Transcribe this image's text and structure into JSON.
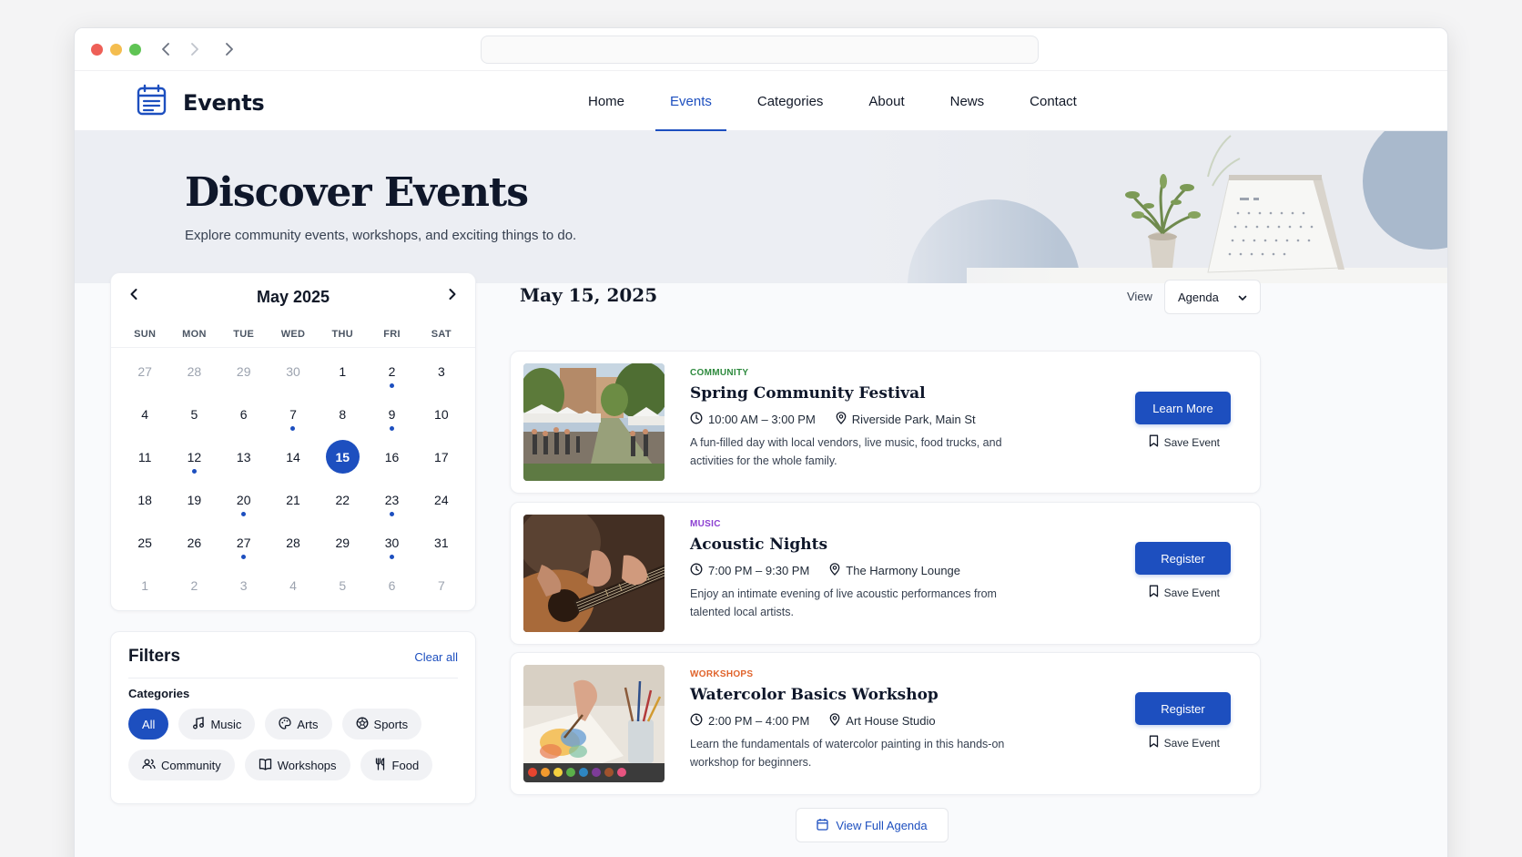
{
  "site": {
    "brand": "Events",
    "brand_icon": "calendar-icon"
  },
  "nav": {
    "items": [
      {
        "label": "Home",
        "active": false
      },
      {
        "label": "Events",
        "active": true
      },
      {
        "label": "Categories",
        "active": false
      },
      {
        "label": "About",
        "active": false
      },
      {
        "label": "News",
        "active": false
      },
      {
        "label": "Contact",
        "active": false
      }
    ]
  },
  "hero": {
    "title": "Discover Events",
    "subtitle": "Explore community events, workshops, and exciting things to do."
  },
  "calendar": {
    "month": "May 2025",
    "weekdays": [
      "SUN",
      "MON",
      "TUE",
      "WED",
      "THU",
      "FRI",
      "SAT"
    ],
    "selected": "15",
    "days": [
      {
        "d": "27",
        "m": true
      },
      {
        "d": "28",
        "m": true
      },
      {
        "d": "29",
        "m": true
      },
      {
        "d": "30",
        "m": true
      },
      {
        "d": "1"
      },
      {
        "d": "2",
        "e": true
      },
      {
        "d": "3"
      },
      {
        "d": "4"
      },
      {
        "d": "5"
      },
      {
        "d": "6"
      },
      {
        "d": "7",
        "e": true
      },
      {
        "d": "8"
      },
      {
        "d": "9",
        "e": true
      },
      {
        "d": "10"
      },
      {
        "d": "11"
      },
      {
        "d": "12",
        "e": true
      },
      {
        "d": "13"
      },
      {
        "d": "14"
      },
      {
        "d": "15",
        "s": true
      },
      {
        "d": "16"
      },
      {
        "d": "17"
      },
      {
        "d": "18"
      },
      {
        "d": "19"
      },
      {
        "d": "20",
        "e": true
      },
      {
        "d": "21"
      },
      {
        "d": "22"
      },
      {
        "d": "23",
        "e": true
      },
      {
        "d": "24"
      },
      {
        "d": "25"
      },
      {
        "d": "26"
      },
      {
        "d": "27",
        "e": true
      },
      {
        "d": "28"
      },
      {
        "d": "29"
      },
      {
        "d": "30",
        "e": true
      },
      {
        "d": "31"
      },
      {
        "d": "1",
        "m": true
      },
      {
        "d": "2",
        "m": true
      },
      {
        "d": "3",
        "m": true
      },
      {
        "d": "4",
        "m": true
      },
      {
        "d": "5",
        "m": true
      },
      {
        "d": "6",
        "m": true
      },
      {
        "d": "7",
        "m": true
      }
    ]
  },
  "filters": {
    "title": "Filters",
    "clear_label": "Clear all",
    "categories_label": "Categories",
    "chips": [
      {
        "label": "All",
        "icon": "",
        "active": true
      },
      {
        "label": "Music",
        "icon": "music-note-icon"
      },
      {
        "label": "Arts",
        "icon": "palette-icon"
      },
      {
        "label": "Sports",
        "icon": "ball-icon"
      },
      {
        "label": "Community",
        "icon": "users-icon"
      },
      {
        "label": "Workshops",
        "icon": "book-icon"
      },
      {
        "label": "Food",
        "icon": "utensils-icon"
      }
    ]
  },
  "agenda": {
    "date": "May 15, 2025",
    "view_label": "View",
    "view_value": "Agenda",
    "full_agenda_label": "View Full Agenda",
    "events": [
      {
        "category": "COMMUNITY",
        "category_color": "#2e8a3e",
        "title": "Spring Community Festival",
        "time": "10:00 AM – 3:00 PM",
        "location": "Riverside Park, Main St",
        "description": "A fun-filled day with local vendors, live music, food trucks, and activities for the whole family.",
        "action": "Learn More",
        "save": "Save Event"
      },
      {
        "category": "MUSIC",
        "category_color": "#8b3fd1",
        "title": "Acoustic Nights",
        "time": "7:00 PM – 9:30 PM",
        "location": "The Harmony Lounge",
        "description": "Enjoy an intimate evening of live acoustic performances from talented local artists.",
        "action": "Register",
        "save": "Save Event"
      },
      {
        "category": "WORKSHOPS",
        "category_color": "#e0632b",
        "title": "Watercolor Basics Workshop",
        "time": "2:00 PM – 4:00 PM",
        "location": "Art House Studio",
        "description": "Learn the fundamentals of watercolor painting in this hands-on workshop for beginners.",
        "action": "Register",
        "save": "Save Event"
      }
    ]
  },
  "colors": {
    "accent": "#1d4fbf"
  }
}
